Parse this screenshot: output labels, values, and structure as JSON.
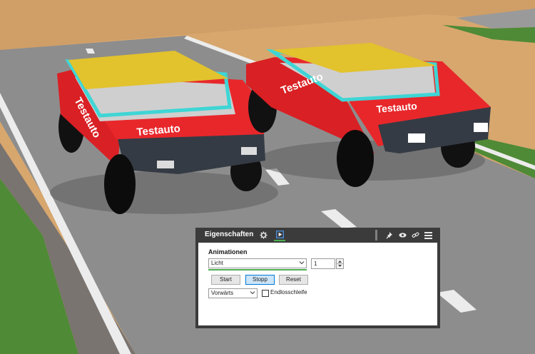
{
  "scene": {
    "colors": {
      "car_body": "#e8272b",
      "car_roof": "#e2c22d",
      "car_frame": "#3fd5d5",
      "road": "#8d8d8d",
      "grass": "#4f8a36",
      "ground": "#d7a76e"
    },
    "cars": [
      {
        "decal_hood": "Testauto",
        "decal_side": "Testauto"
      },
      {
        "decal_hood": "Testauto",
        "decal_side": "Testauto"
      }
    ]
  },
  "panel": {
    "title": "Eigenschaften",
    "header_icons": [
      "gear-icon",
      "animation-tab-icon",
      "pin-icon",
      "eye-icon",
      "link-icon",
      "menu-icon"
    ],
    "accent_color": "#4caf50",
    "section_title": "Animationen",
    "animation_select": {
      "value": "Licht"
    },
    "repeat_count": {
      "value": "1"
    },
    "buttons": {
      "start": "Start",
      "stopp": "Stopp",
      "reset": "Reset"
    },
    "direction_select": {
      "value": "Vorwärts"
    },
    "loop_checkbox": {
      "label": "Endlosschleife",
      "checked": false
    }
  }
}
